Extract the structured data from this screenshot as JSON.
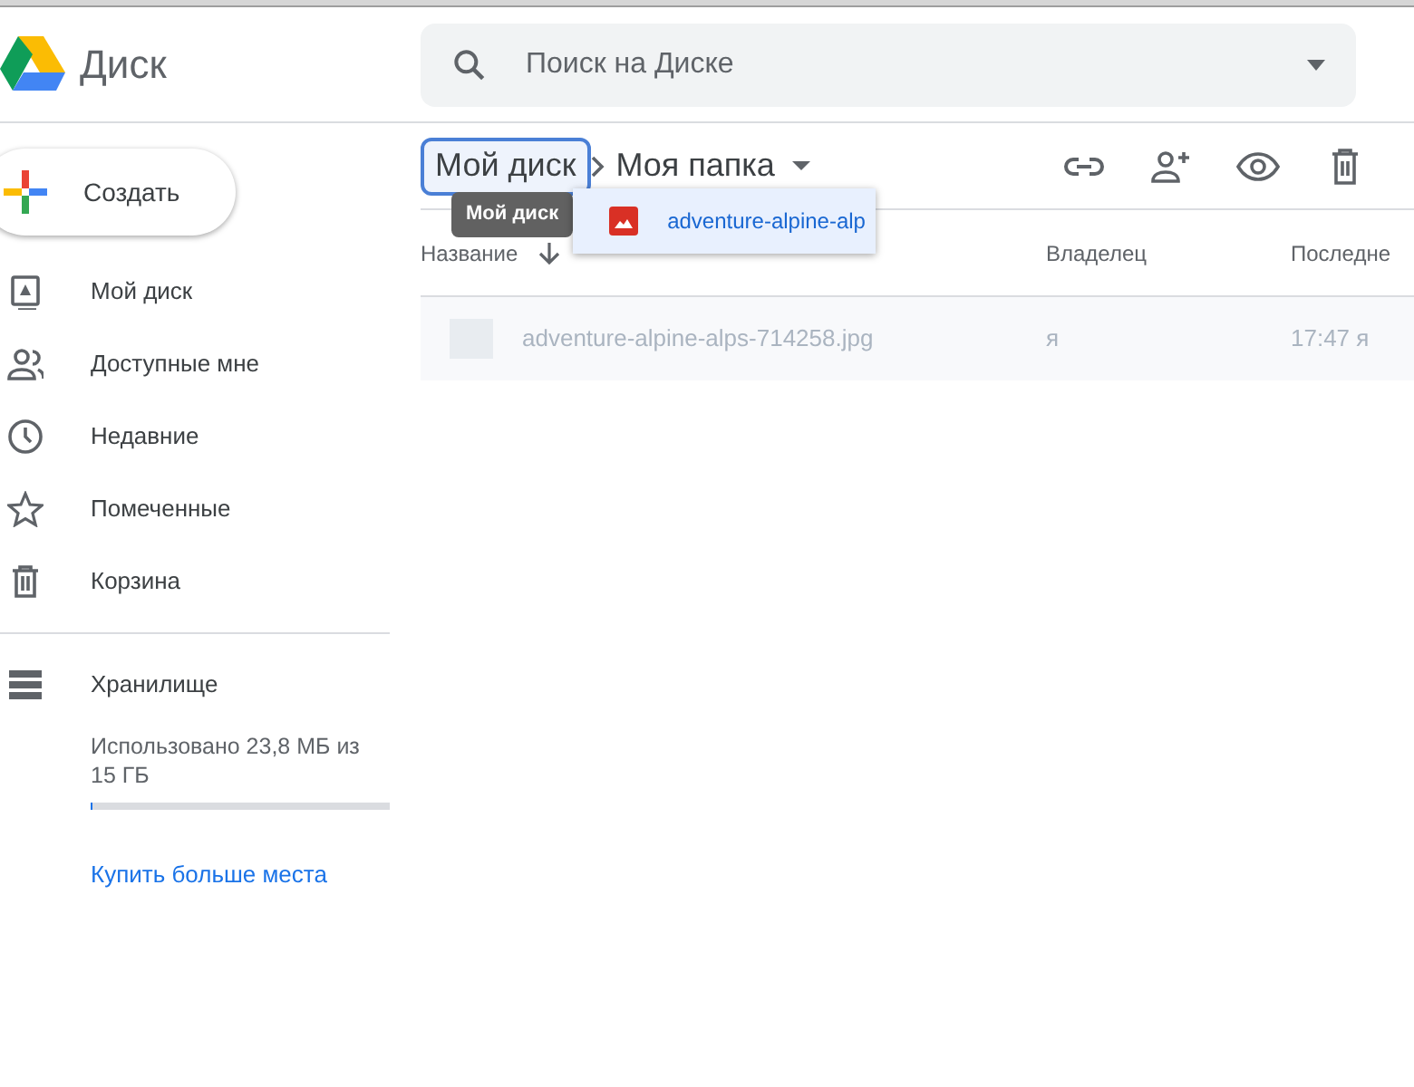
{
  "app": {
    "title": "Диск"
  },
  "search": {
    "placeholder": "Поиск на Диске"
  },
  "create_button": {
    "label": "Создать"
  },
  "sidebar": {
    "items": [
      {
        "label": "Мой диск",
        "selected": false
      },
      {
        "label": "Доступные мне",
        "selected": false
      },
      {
        "label": "Недавние",
        "selected": false
      },
      {
        "label": "Помеченные",
        "selected": false
      },
      {
        "label": "Корзина",
        "selected": false
      }
    ]
  },
  "storage": {
    "label": "Хранилище",
    "usage": "Использовано 23,8 МБ из 15 ГБ",
    "level": 0.002,
    "buy_link": "Купить больше места"
  },
  "breadcrumb": [
    {
      "label": "Мой диск",
      "hovered": true
    },
    {
      "label": "Моя папка",
      "hovered": false
    }
  ],
  "table": {
    "columns": [
      "Название",
      "Владелец",
      "Последне"
    ],
    "rows": [
      {
        "name": "adventure-alpine-alps-714258.jpg",
        "owner": "я",
        "modified": "17:47 я",
        "dragging": true
      }
    ]
  },
  "drag": {
    "tooltip": "Мой диск",
    "file": "adventure-alpine-alp"
  }
}
